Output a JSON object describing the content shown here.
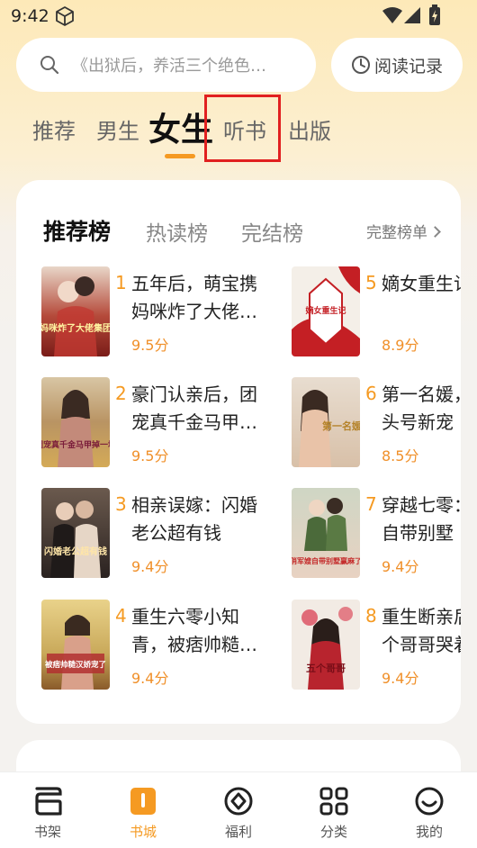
{
  "status_bar": {
    "time": "9:42"
  },
  "search": {
    "placeholder": "《出狱后，养活三个绝色…",
    "history_label": "阅读记录"
  },
  "top_tabs": [
    {
      "label": "推荐",
      "active": false
    },
    {
      "label": "男生",
      "active": false
    },
    {
      "label": "女生",
      "active": true
    },
    {
      "label": "听书",
      "active": false
    },
    {
      "label": "出版",
      "active": false
    }
  ],
  "ranking": {
    "tabs": [
      {
        "label": "推荐榜",
        "active": true
      },
      {
        "label": "热读榜",
        "active": false
      },
      {
        "label": "完结榜",
        "active": false
      }
    ],
    "full_list_label": "完整榜单",
    "books": [
      {
        "rank": "1",
        "title": "五年后，萌宝携妈咪炸了大佬…",
        "score": "9.5分",
        "cover_text": "妈咪炸了大佬集团"
      },
      {
        "rank": "2",
        "title": "豪门认亲后，团宠真千金马甲…",
        "score": "9.5分",
        "cover_text": "团宠真千金马甲掉一地"
      },
      {
        "rank": "3",
        "title": "相亲误嫁：闪婚老公超有钱",
        "score": "9.4分",
        "cover_text": "闪婚老公超有钱"
      },
      {
        "rank": "4",
        "title": "重生六零小知青，被痞帅糙…",
        "score": "9.4分",
        "cover_text": "被痞帅糙汉娇宠了"
      },
      {
        "rank": "5",
        "title": "嫡女重生记",
        "score": "8.9分",
        "cover_text": "嫡女重生记"
      },
      {
        "rank": "6",
        "title": "第一名媛，她的头号新宠",
        "score": "8.5分",
        "cover_text": "第一名媛"
      },
      {
        "rank": "7",
        "title": "穿越七零：嫂嫂自带别墅",
        "score": "9.4分",
        "cover_text": "俏军嫂自带别墅赢麻了"
      },
      {
        "rank": "8",
        "title": "重生断亲后，五个哥哥哭着",
        "score": "9.4分",
        "cover_text": "五个哥哥"
      }
    ]
  },
  "bottom_nav": [
    {
      "label": "书架",
      "icon": "bookshelf-icon",
      "active": false
    },
    {
      "label": "书城",
      "icon": "bookstore-icon",
      "active": true
    },
    {
      "label": "福利",
      "icon": "welfare-icon",
      "active": false
    },
    {
      "label": "分类",
      "icon": "category-icon",
      "active": false
    },
    {
      "label": "我的",
      "icon": "profile-icon",
      "active": false
    }
  ],
  "colors": {
    "accent": "#f59a22",
    "score": "#f0902a",
    "highlight": "#e12020"
  }
}
